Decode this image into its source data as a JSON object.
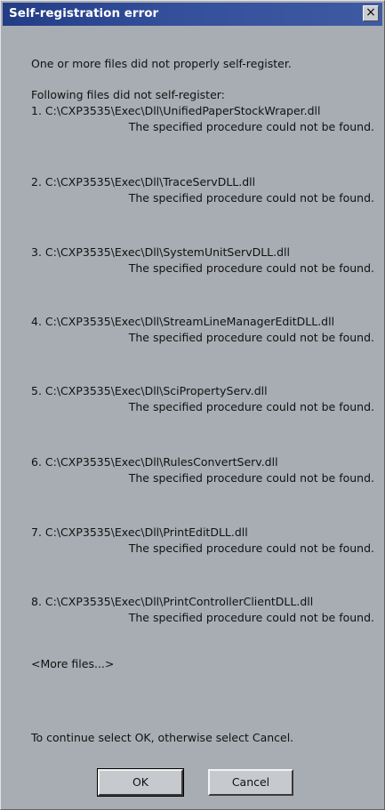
{
  "window": {
    "title": "Self-registration error",
    "close_glyph": "×"
  },
  "message": {
    "intro": "One or more files did not properly self-register.",
    "list_header": "Following files did not self-register:",
    "files": [
      {
        "path": "1. C:\\CXP3535\\Exec\\Dll\\UnifiedPaperStockWraper.dll",
        "reason": "The specified procedure could not be found."
      },
      {
        "path": "2. C:\\CXP3535\\Exec\\Dll\\TraceServDLL.dll",
        "reason": "The specified procedure could not be found."
      },
      {
        "path": "3. C:\\CXP3535\\Exec\\Dll\\SystemUnitServDLL.dll",
        "reason": "The specified procedure could not be found."
      },
      {
        "path": "4. C:\\CXP3535\\Exec\\Dll\\StreamLineManagerEditDLL.dll",
        "reason": "The specified procedure could not be found."
      },
      {
        "path": "5. C:\\CXP3535\\Exec\\Dll\\SciPropertyServ.dll",
        "reason": "The specified procedure could not be found."
      },
      {
        "path": "6. C:\\CXP3535\\Exec\\Dll\\RulesConvertServ.dll",
        "reason": "The specified procedure could not be found."
      },
      {
        "path": "7. C:\\CXP3535\\Exec\\Dll\\PrintEditDLL.dll",
        "reason": "The specified procedure could not be found."
      },
      {
        "path": "8. C:\\CXP3535\\Exec\\Dll\\PrintControllerClientDLL.dll",
        "reason": "The specified procedure could not be found."
      }
    ],
    "more_files": "<More files...>",
    "footer": "To continue select OK, otherwise select Cancel."
  },
  "buttons": {
    "ok": "OK",
    "cancel": "Cancel"
  },
  "colors": {
    "title_bar": "#2f4a95",
    "dialog_bg": "#a8adb3",
    "button_face": "#c6cacf"
  }
}
